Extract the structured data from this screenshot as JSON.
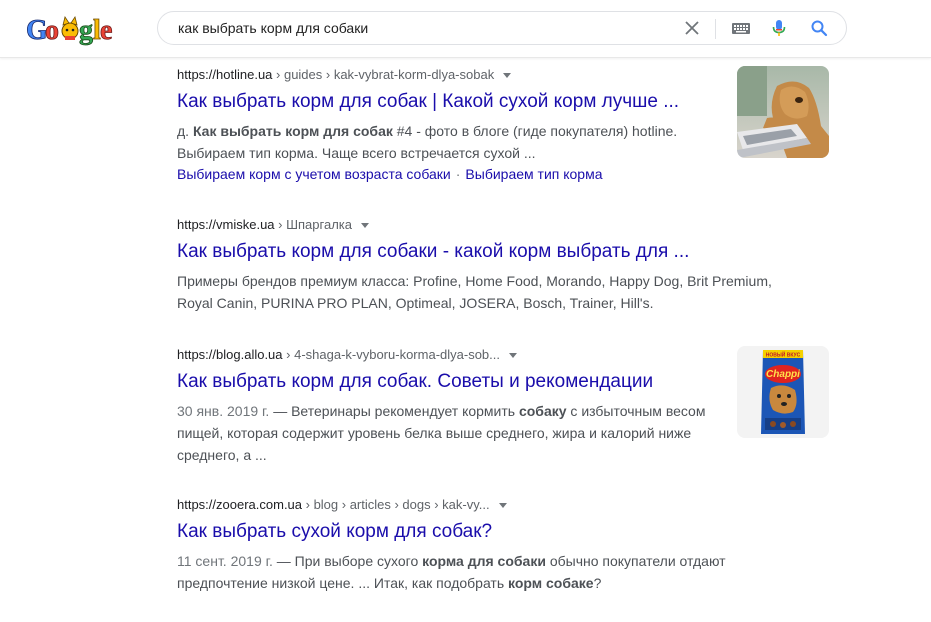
{
  "search": {
    "query": "как выбрать корм для собаки"
  },
  "results": [
    {
      "site": "https://hotline.ua",
      "path": " › guides › kak-vybrat-korm-dlya-sobak",
      "title": "Как выбрать корм для собак | Какой сухой корм лучше ...",
      "snippet": [
        {
          "text": "д. "
        },
        {
          "text": "Как выбрать корм для собак",
          "bold": true
        },
        {
          "text": " #4 - фото в блоге (гиде покупателя) hotline. Выбираем тип корма. Чаще всего встречается сухой ..."
        }
      ],
      "sitelinks": [
        "Выбираем корм с учетом возраста собаки",
        "Выбираем тип корма"
      ]
    },
    {
      "site": "https://vmiske.ua",
      "path": " › Шпаргалка",
      "title": "Как выбрать корм для собаки - какой корм выбрать для ...",
      "snippet": [
        {
          "text": "Примеры брендов премиум класса: Profine, Home Food, Morando, Happy Dog, Brit Premium, Royal Canin, PURINA PRO PLAN, Optimeal, JOSERA, Bosch, Trainer, Hill's."
        }
      ]
    },
    {
      "site": "https://blog.allo.ua",
      "path": " › 4-shaga-k-vyboru-korma-dlya-sob...",
      "title": "Как выбрать корм для собак. Советы и рекомендации",
      "snippet": [
        {
          "text": "30 янв. 2019 г.",
          "date": true
        },
        {
          "text": " — Ветеринары рекомендует кормить "
        },
        {
          "text": "собаку",
          "bold": true
        },
        {
          "text": " с избыточным весом пищей, которая содержит уровень белка выше среднего, жира и калорий ниже среднего, а ..."
        }
      ]
    },
    {
      "site": "https://zooera.com.ua",
      "path": " › blog › articles › dogs › kak-vy...",
      "title": "Как выбрать сухой корм для собак?",
      "snippet": [
        {
          "text": "11 сент. 2019 г.",
          "date": true
        },
        {
          "text": " — При выборе сухого "
        },
        {
          "text": "корма для собаки",
          "bold": true
        },
        {
          "text": " обычно покупатели отдают предпочтение низкой цене. ... Итак, как подобрать "
        },
        {
          "text": "корм собаке",
          "bold": true
        },
        {
          "text": "?"
        }
      ]
    }
  ],
  "colors": {
    "link": "#1a0dab",
    "snippet": "#4d5156",
    "cite": "#202124",
    "mic_blue": "#4285f4",
    "mic_red": "#ea4335"
  },
  "icons": [
    "google-doodle-logo",
    "clear-icon",
    "keyboard-icon",
    "microphone-icon",
    "search-icon",
    "caret-down-icon"
  ],
  "thumbnails": {
    "product_label": "Chappi",
    "product_badge": "НОВЫЙ ВКУС"
  }
}
